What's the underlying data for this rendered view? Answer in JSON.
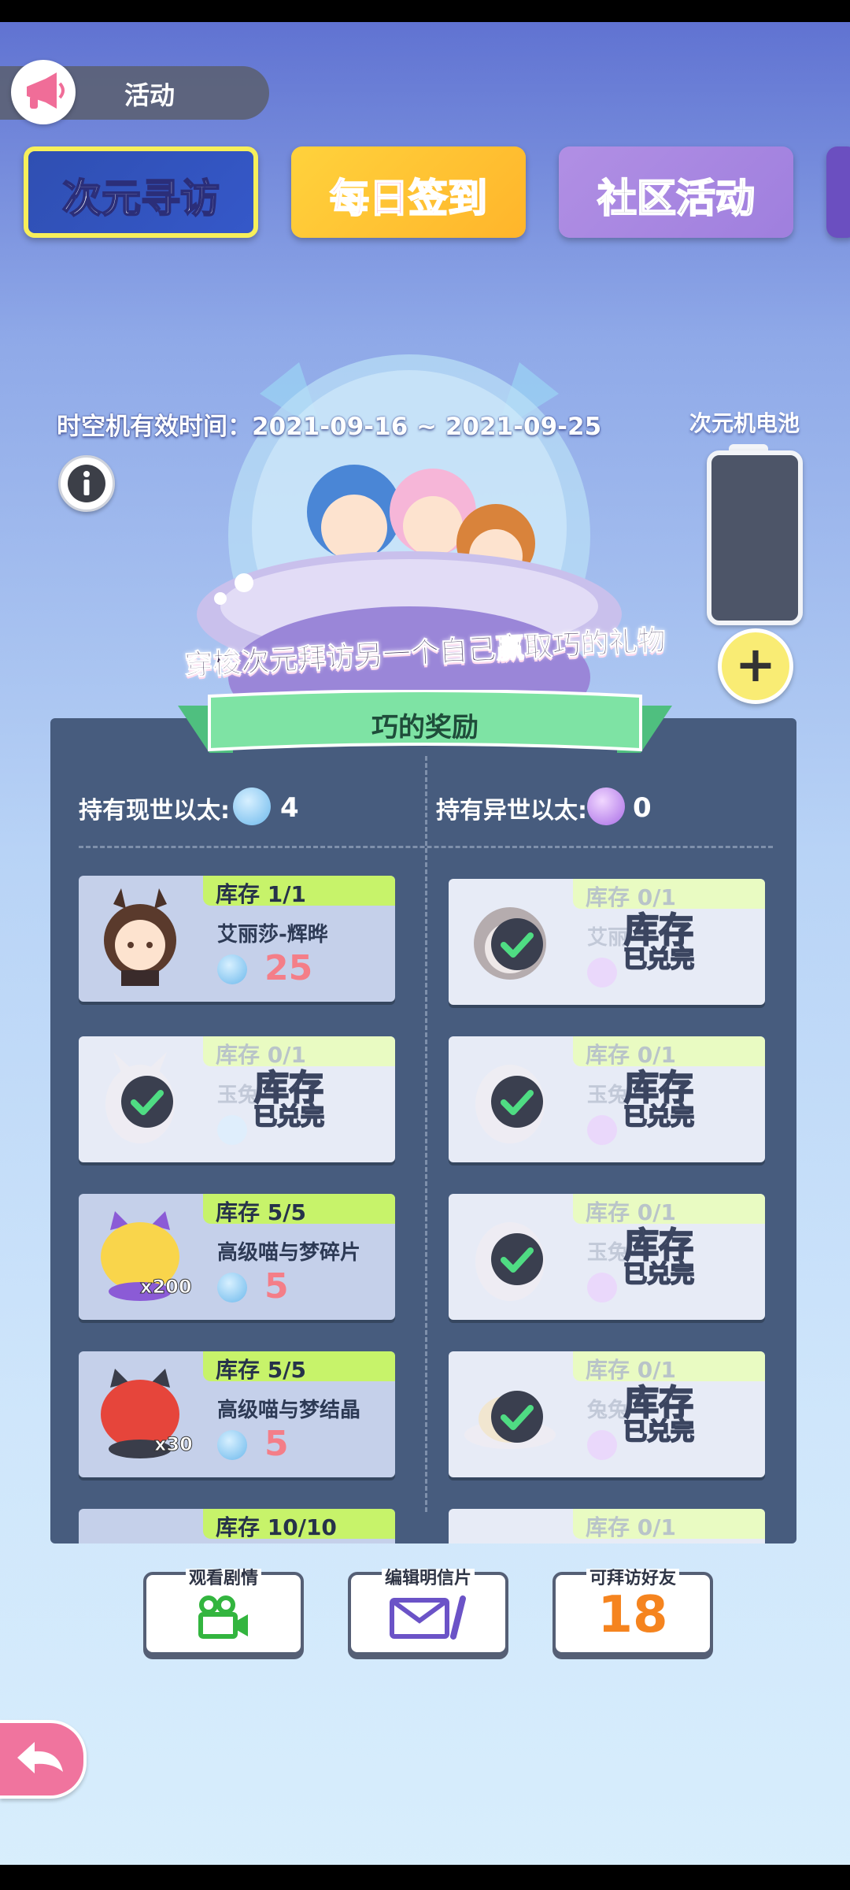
{
  "activity": {
    "label": "活动",
    "icon": "megaphone-icon"
  },
  "banners": [
    {
      "label": "次元寻访",
      "selected": true
    },
    {
      "label": "每日签到",
      "selected": false
    },
    {
      "label": "社区活动",
      "selected": false
    }
  ],
  "machine": {
    "valid_time": "时空机有效时间：2021-09-16 ~ 2021-09-25",
    "battery_label": "次元机电池",
    "plus": "+"
  },
  "slogan": "穿梭次元拜访另一个自己赢取巧的礼物",
  "panel": {
    "title": "巧的奖励",
    "left_hold": "持有现世以太:",
    "left_count": "4",
    "right_hold": "持有异世以太:",
    "right_count": "0"
  },
  "left_items": [
    {
      "stock": "库存 1/1",
      "name": "艾丽莎-辉晔",
      "price": "25",
      "sold_out": false
    },
    {
      "stock": "库存 0/1",
      "name": "玉兔",
      "price": "",
      "sold_out": true
    },
    {
      "stock": "库存 5/5",
      "name": "高级喵与梦碎片",
      "price": "5",
      "sold_out": false,
      "qty": "x200"
    },
    {
      "stock": "库存 5/5",
      "name": "高级喵与梦结晶",
      "price": "5",
      "sold_out": false,
      "qty": "x30"
    },
    {
      "stock": "库存 10/10"
    }
  ],
  "right_items": [
    {
      "stock": "库存 0/1",
      "name": "艾丽",
      "sold_out": true
    },
    {
      "stock": "库存 0/1",
      "name": "玉兔",
      "sold_out": true
    },
    {
      "stock": "库存 0/1",
      "name": "玉兔",
      "sold_out": true
    },
    {
      "stock": "库存 0/1",
      "name": "兔兔",
      "sold_out": true
    },
    {
      "stock": "库存 0/1"
    }
  ],
  "sold_out_text": {
    "line1": "库存",
    "line2": "已兑完"
  },
  "bottom_buttons": [
    {
      "label": "观看剧情",
      "icon": "video-camera-icon"
    },
    {
      "label": "编辑明信片",
      "icon": "envelope-pen-icon"
    },
    {
      "label": "可拜访好友",
      "count": "18"
    }
  ],
  "colors": {
    "panel": "#475c7e",
    "stock_tag": "#c7f36a",
    "price": "#f47e88",
    "ribbon": "#7ee3a4",
    "back_button": "#f0749e"
  }
}
